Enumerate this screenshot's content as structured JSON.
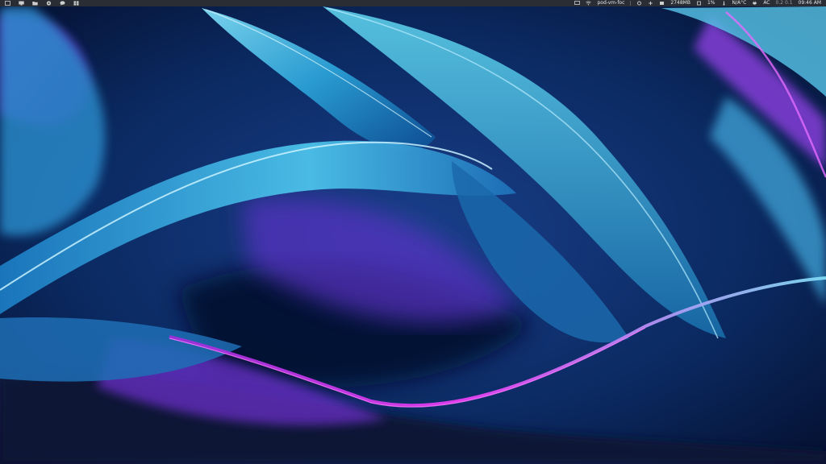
{
  "panel": {
    "network_label": "pod-vm-foc",
    "memory": "2748MB",
    "cpu": "1%",
    "temperature": "N/A°C",
    "power": "AC",
    "workspaces": "0.2 0.1",
    "clock": "09:46 AM"
  },
  "colors": {
    "panel_bg": "#2a2d33",
    "accent_cyan": "#39b6e0",
    "accent_magenta": "#d836e8",
    "deep_blue": "#06153a"
  },
  "icons": {
    "launcher": "terminal-icon",
    "files": "folder-icon",
    "browser": "browser-icon",
    "chat": "chat-icon",
    "apps": "grid-icon"
  }
}
